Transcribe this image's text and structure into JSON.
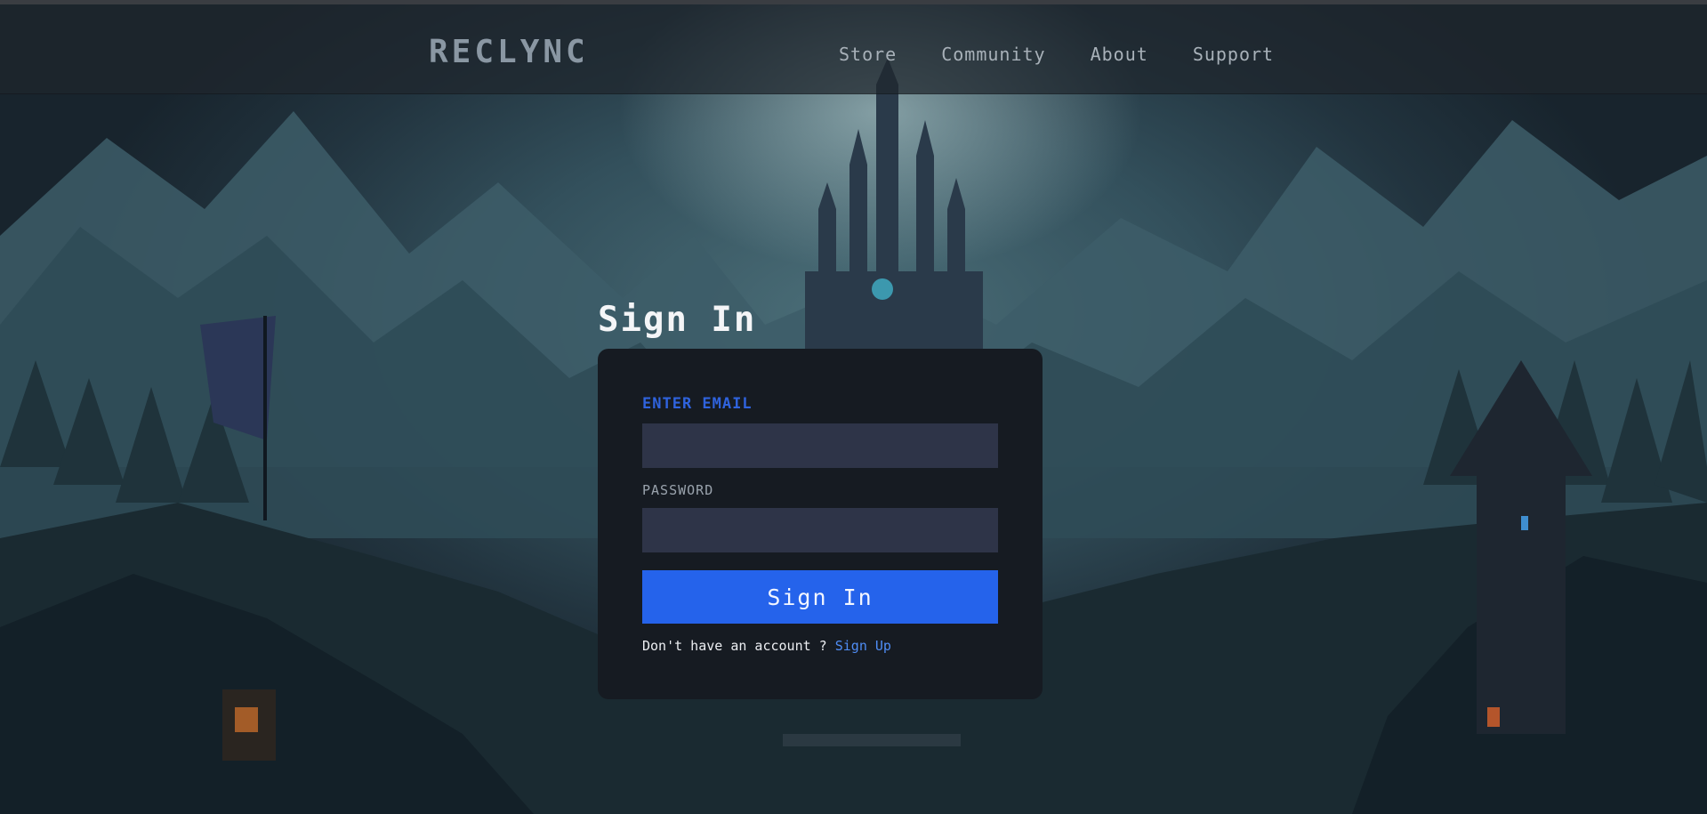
{
  "brand": {
    "logo_text": "RECLYNC"
  },
  "nav": {
    "items": [
      {
        "label": "Store"
      },
      {
        "label": "Community"
      },
      {
        "label": "About"
      },
      {
        "label": "Support"
      }
    ]
  },
  "signin": {
    "heading": "Sign In",
    "email_label": "ENTER EMAIL",
    "email_value": "",
    "password_label": "PASSWORD",
    "password_value": "",
    "submit_label": "Sign In",
    "no_account_text": "Don't have an account ? ",
    "signup_link_label": "Sign Up"
  },
  "colors": {
    "accent": "#2563eb",
    "card_bg": "#161b22",
    "input_bg": "#2e3448",
    "link": "#4f8df5",
    "email_label": "#2f63dd"
  },
  "background": {
    "icon": "fantasy-castle-landscape-icon"
  }
}
